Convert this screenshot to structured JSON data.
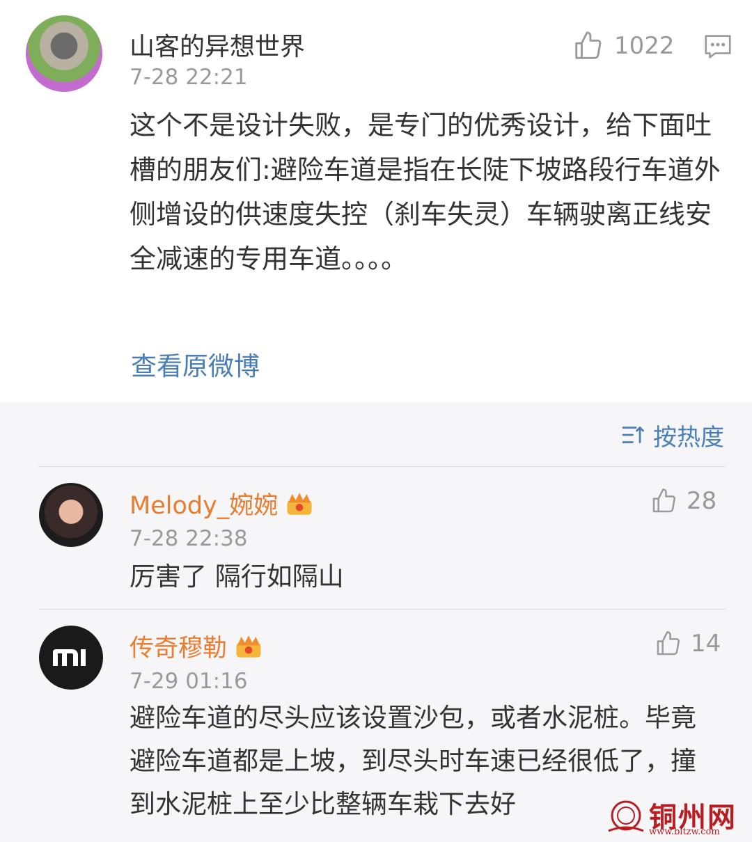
{
  "post": {
    "author": "山客的异想世界",
    "time": "7-28 22:21",
    "like_count": "1022",
    "text": "这个不是设计失败，是专门的优秀设计，给下面吐槽的朋友们:避险车道是指在长陡下坡路段行车道外侧增设的供速度失控（刹车失灵）车辆驶离正线安全减速的专用车道。。。。",
    "view_original": "查看原微博"
  },
  "comments_header": {
    "sort_label": "按热度"
  },
  "comments": [
    {
      "name": "Melody_婉婉",
      "time": "7-28 22:38",
      "likes": "28",
      "text": "厉害了 隔行如隔山"
    },
    {
      "name": "传奇穆勒",
      "time": "7-29 01:16",
      "likes": "14",
      "text": "避险车道的尽头应该设置沙包，或者水泥桩。毕竟避险车道都是上坡，到尽头时车速已经很低了，撞到水泥桩上至少比整辆车栽下去好"
    }
  ],
  "watermark": {
    "text": "铜州网",
    "url": "www.bltzw.com"
  },
  "icons": {
    "like": "thumbs-up-icon",
    "comment": "comment-icon",
    "sort": "sort-icon",
    "vip": "crown-badge-icon"
  },
  "colors": {
    "link": "#4a7fb5",
    "vip_name": "#e87c2f",
    "meta": "#9a9a9a",
    "comments_bg": "#f6f5f8",
    "watermark": "#b81d22"
  }
}
